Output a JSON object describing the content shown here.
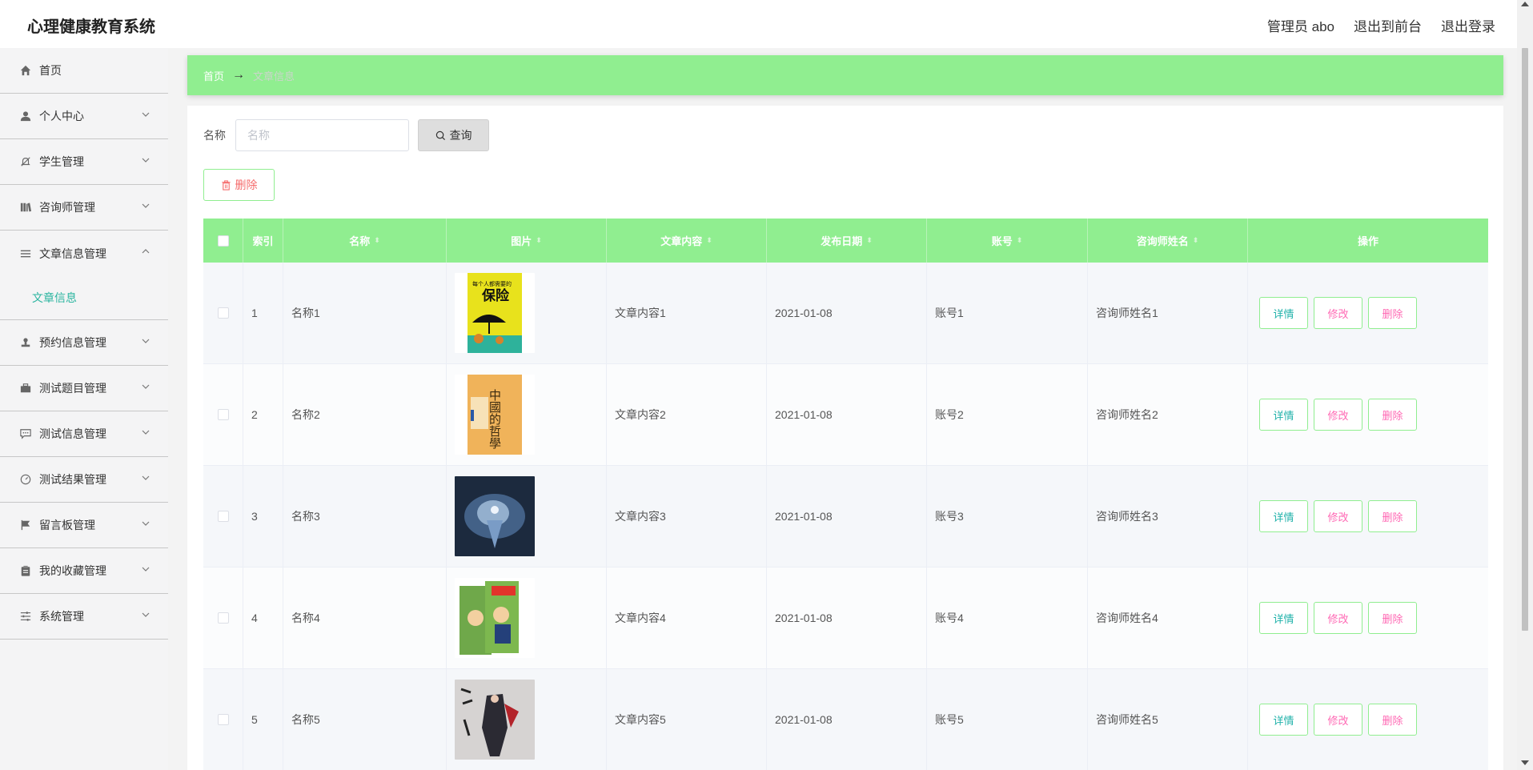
{
  "app": {
    "title": "心理健康教育系统"
  },
  "header": {
    "user_label": "管理员 abo",
    "front_label": "退出到前台",
    "logout_label": "退出登录"
  },
  "sidebar": {
    "items": [
      {
        "label": "首页",
        "icon": "home-icon"
      },
      {
        "label": "个人中心",
        "icon": "user-icon"
      },
      {
        "label": "学生管理",
        "icon": "bell-off-icon"
      },
      {
        "label": "咨询师管理",
        "icon": "books-icon"
      },
      {
        "label": "文章信息管理",
        "icon": "menu-icon",
        "expanded": true,
        "children": [
          {
            "label": "文章信息",
            "active": true
          }
        ]
      },
      {
        "label": "预约信息管理",
        "icon": "stamp-icon"
      },
      {
        "label": "测试题目管理",
        "icon": "briefcase-icon"
      },
      {
        "label": "测试信息管理",
        "icon": "chat-icon"
      },
      {
        "label": "测试结果管理",
        "icon": "gauge-icon"
      },
      {
        "label": "留言板管理",
        "icon": "flag-icon"
      },
      {
        "label": "我的收藏管理",
        "icon": "clipboard-icon"
      },
      {
        "label": "系统管理",
        "icon": "sliders-icon"
      }
    ]
  },
  "breadcrumb": {
    "home": "首页",
    "separator": "→",
    "current": "文章信息"
  },
  "search": {
    "label": "名称",
    "placeholder": "名称",
    "button_label": "查询"
  },
  "toolbar": {
    "delete_label": "删除"
  },
  "table": {
    "headers": {
      "index": "索引",
      "name": "名称",
      "image": "图片",
      "content": "文章内容",
      "date": "发布日期",
      "account": "账号",
      "consultant": "咨询师姓名",
      "ops": "操作"
    },
    "sort_glyph": "⬍",
    "rows": [
      {
        "index": "1",
        "name": "名称1",
        "content": "文章内容1",
        "date": "2021-01-08",
        "account": "账号1",
        "consultant": "咨询师姓名1",
        "image_alt": "book-cover-insurance"
      },
      {
        "index": "2",
        "name": "名称2",
        "content": "文章内容2",
        "date": "2021-01-08",
        "account": "账号2",
        "consultant": "咨询师姓名2",
        "image_alt": "book-cover-philosophy"
      },
      {
        "index": "3",
        "name": "名称3",
        "content": "文章内容3",
        "date": "2021-01-08",
        "account": "账号3",
        "consultant": "咨询师姓名3",
        "image_alt": "dark-fantasy-art"
      },
      {
        "index": "4",
        "name": "名称4",
        "content": "文章内容4",
        "date": "2021-01-08",
        "account": "账号4",
        "consultant": "咨询师姓名4",
        "image_alt": "comic-book-stack"
      },
      {
        "index": "5",
        "name": "名称5",
        "content": "文章内容5",
        "date": "2021-01-08",
        "account": "账号5",
        "consultant": "咨询师姓名5",
        "image_alt": "warrior-illustration"
      }
    ],
    "ops": {
      "detail": "详情",
      "edit": "修改",
      "delete": "删除"
    }
  },
  "images": {
    "insurance_title": "保险",
    "insurance_subtitle": "每个人都需要的",
    "philosophy_title": "中國的哲學"
  },
  "colors": {
    "accent_green": "#90ee90",
    "active_teal": "#2bb5a0",
    "danger": "#f56c6c",
    "pink": "#ff69b4",
    "detail_teal": "#20b2aa"
  }
}
